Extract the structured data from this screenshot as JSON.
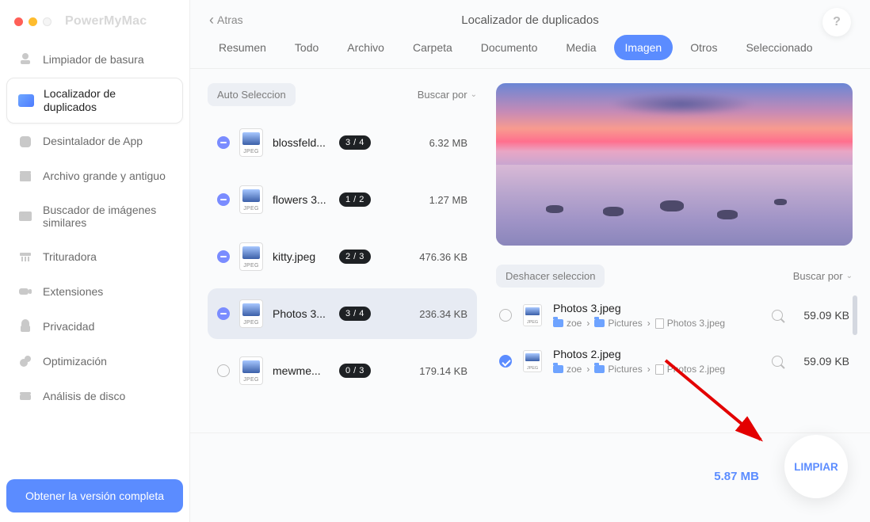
{
  "brand": "PowerMyMac",
  "header": {
    "back_label": "Atras",
    "title": "Localizador de duplicados",
    "help_glyph": "?"
  },
  "sidebar": {
    "items": [
      {
        "label": "Limpiador de basura"
      },
      {
        "label": "Localizador de duplicados"
      },
      {
        "label": "Desintalador de App"
      },
      {
        "label": "Archivo grande y antiguo"
      },
      {
        "label": "Buscador de imágenes similares"
      },
      {
        "label": "Trituradora"
      },
      {
        "label": "Extensiones"
      },
      {
        "label": "Privacidad"
      },
      {
        "label": "Optimización"
      },
      {
        "label": "Análisis de disco"
      }
    ],
    "cta": "Obtener la versión completa"
  },
  "tabs": [
    "Resumen",
    "Todo",
    "Archivo",
    "Carpeta",
    "Documento",
    "Media",
    "Imagen",
    "Otros",
    "Seleccionado"
  ],
  "active_tab": "Imagen",
  "list": {
    "auto_select": "Auto Seleccion",
    "sort_by": "Buscar por",
    "files": [
      {
        "name": "blossfeld...",
        "badge": "3 / 4",
        "size": "6.32 MB",
        "sel": "part"
      },
      {
        "name": "flowers 3...",
        "badge": "1 / 2",
        "size": "1.27 MB",
        "sel": "part"
      },
      {
        "name": "kitty.jpeg",
        "badge": "2 / 3",
        "size": "476.36 KB",
        "sel": "part"
      },
      {
        "name": "Photos 3...",
        "badge": "3 / 4",
        "size": "236.34 KB",
        "sel": "part",
        "highlight": true
      },
      {
        "name": "mewme...",
        "badge": "0 / 3",
        "size": "179.14 KB",
        "sel": "none"
      }
    ]
  },
  "details": {
    "undo": "Deshacer seleccion",
    "sort_by": "Buscar por",
    "crumb_zoe": "zoe",
    "crumb_pictures": "Pictures",
    "items": [
      {
        "name": "Photos 3.jpeg",
        "file": "Photos 3.jpeg",
        "size": "59.09 KB",
        "checked": false
      },
      {
        "name": "Photos 2.jpeg",
        "file": "Photos 2.jpeg",
        "size": "59.09 KB",
        "checked": true
      }
    ]
  },
  "footer": {
    "total": "5.87 MB",
    "clean": "LIMPIAR"
  },
  "thumb_ext": "JPEG",
  "crumb_sep": "›"
}
